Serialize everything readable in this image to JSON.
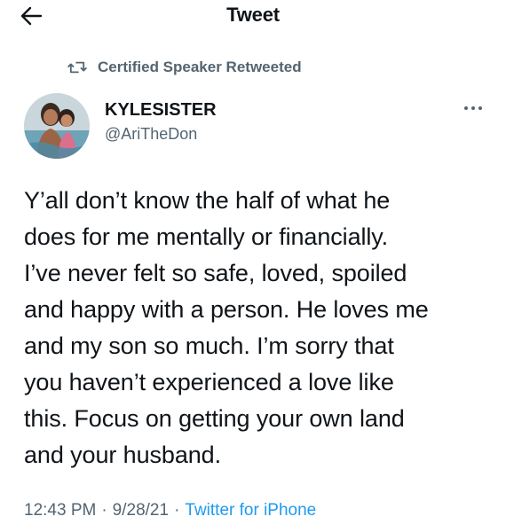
{
  "header": {
    "title": "Tweet",
    "back_icon": "arrow-left-icon"
  },
  "retweet": {
    "icon": "retweet-icon",
    "label": "Certified Speaker Retweeted"
  },
  "user": {
    "name": "KYLESISTER",
    "handle": "@AriTheDon",
    "more_icon": "more-horizontal-icon"
  },
  "tweet": {
    "text": "Y’all don’t know the half of what he\ndoes for me mentally or financially.\nI’ve never felt so safe, loved, spoiled\nand happy with a person. He loves me\nand my son so much. I’m sorry that\nyou haven’t experienced a love like\nthis. Focus on getting your own land\nand your husband.",
    "time": "12:43 PM",
    "date": "9/28/21",
    "separator": "·",
    "source": "Twitter for iPhone"
  },
  "colors": {
    "text": "#0f1419",
    "secondary": "#536471",
    "accent": "#1d9bf0"
  }
}
